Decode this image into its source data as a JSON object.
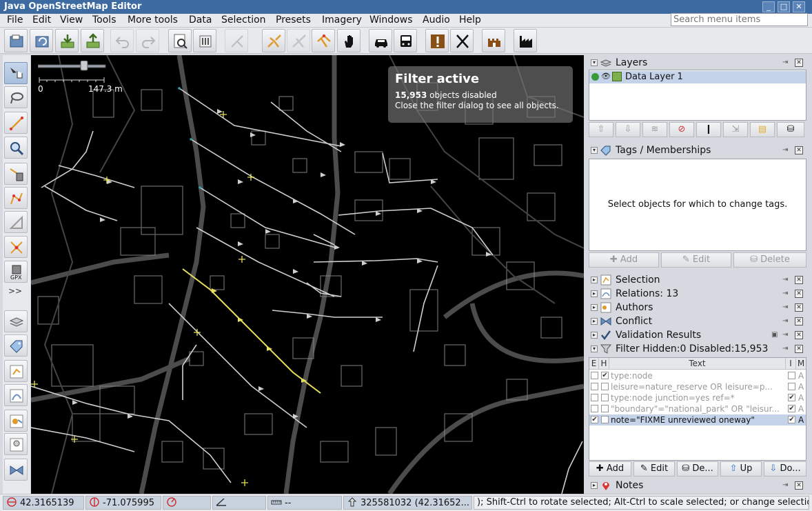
{
  "window": {
    "title": "Java OpenStreetMap Editor",
    "buttons": [
      "_",
      "□",
      "✕"
    ]
  },
  "menubar": {
    "items": [
      {
        "label": "File",
        "key": "F"
      },
      {
        "label": "Edit",
        "key": "E"
      },
      {
        "label": "View",
        "key": "V"
      },
      {
        "label": "Tools",
        "key": "T"
      },
      {
        "label": "More tools",
        "key": "M"
      },
      {
        "label": "Data",
        "key": "D"
      },
      {
        "label": "Selection",
        "key": "S"
      },
      {
        "label": "Presets",
        "key": "P"
      },
      {
        "label": "Imagery",
        "key": "I"
      },
      {
        "label": "Windows",
        "key": "W"
      },
      {
        "label": "Audio",
        "key": "A"
      },
      {
        "label": "Help",
        "key": "H"
      }
    ],
    "search_placeholder": "Search menu items"
  },
  "toolbar": {
    "buttons": [
      "open-icon",
      "download-refresh-icon",
      "download-icon",
      "upload-icon",
      "undo-icon",
      "redo-icon",
      "preferences-icon",
      "filter-icon",
      "merge-icon",
      "split-icon",
      "combine-icon",
      "layer-split-icon",
      "hand-icon",
      "car-icon",
      "bus-icon",
      "validator-icon",
      "food-icon",
      "castle-icon",
      "industry-icon"
    ]
  },
  "map": {
    "scale_min": "0",
    "scale_max": "147.3 m",
    "filter_title": "Filter active",
    "filter_count": "15,953",
    "filter_count_suffix": " objects disabled",
    "filter_hint": "Close the filter dialog to see all objects."
  },
  "panels": {
    "layers": {
      "title": "Layers",
      "items": [
        {
          "name": "Data Layer 1"
        }
      ]
    },
    "tags": {
      "title": "Tags / Memberships",
      "empty_text": "Select objects for which to change tags.",
      "add": "Add",
      "edit": "Edit",
      "delete": "Delete"
    },
    "selection": {
      "title": "Selection"
    },
    "relations": {
      "title": "Relations: 13"
    },
    "authors": {
      "title": "Authors"
    },
    "conflict": {
      "title": "Conflict"
    },
    "validation": {
      "title": "Validation Results"
    },
    "filter": {
      "title": "Filter Hidden:0 Disabled:15,953",
      "columns": [
        "E",
        "H",
        "Text",
        "I",
        "M"
      ],
      "rows": [
        {
          "e": false,
          "h": true,
          "text": "type:node",
          "i": false,
          "m": "A",
          "selected": false
        },
        {
          "e": false,
          "h": false,
          "text": "leisure=nature_reserve OR leisure=p...",
          "i": false,
          "m": "A",
          "selected": false
        },
        {
          "e": false,
          "h": false,
          "text": "type:node junction=yes ref=*",
          "i": true,
          "m": "A",
          "selected": false
        },
        {
          "e": false,
          "h": false,
          "text": "\"boundary\"=\"national_park\" OR \"leisur...",
          "i": true,
          "m": "A",
          "selected": false
        },
        {
          "e": true,
          "h": false,
          "text": "note=\"FIXME unreviewed oneway\"",
          "i": true,
          "m": "A",
          "selected": true
        }
      ],
      "add": "Add",
      "edit": "Edit",
      "delete": "De...",
      "up": "Up",
      "down": "Do..."
    },
    "notes": {
      "title": "Notes"
    }
  },
  "statusbar": {
    "lat": "42.3165139",
    "lon": "-71.075995",
    "heading": "",
    "angle": "",
    "distance": "--",
    "object": "325581032 (42.31652...",
    "message": "); Shift-Ctrl to rotate selected; Alt-Ctrl to scale selected; or change selection"
  },
  "colors": {
    "titlebar": "#3d6aa0",
    "map_bg": "#000000",
    "road": "#cfcfcf",
    "highlight": "#e8e05a",
    "selection": "#c4d3ea"
  }
}
